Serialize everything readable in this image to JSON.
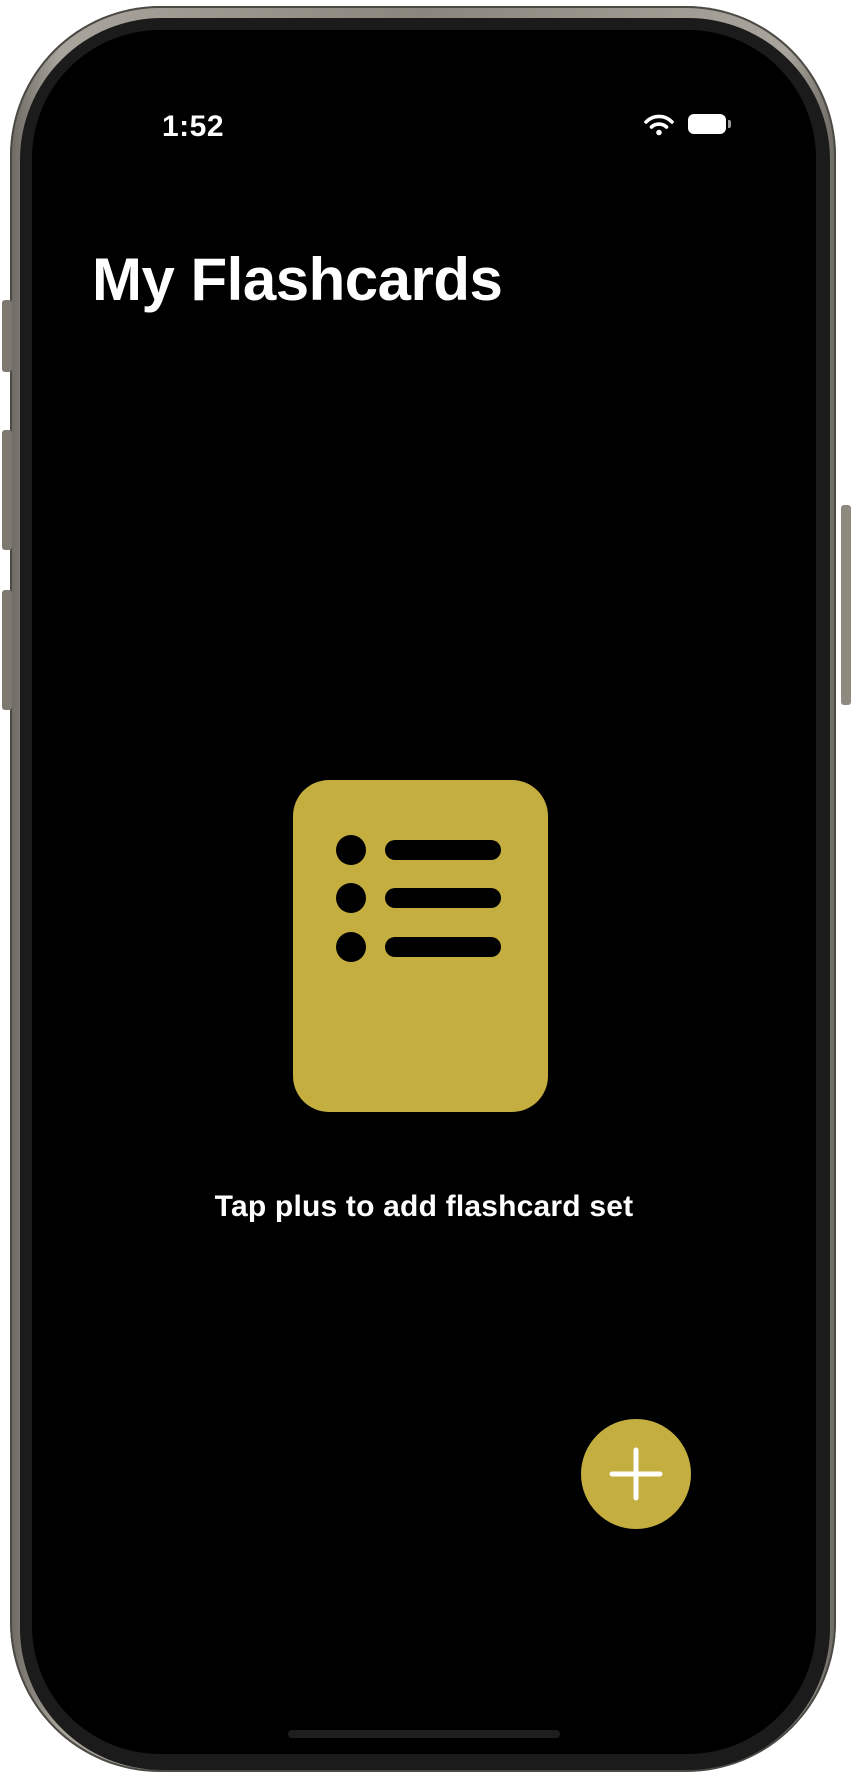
{
  "status_bar": {
    "time": "1:52",
    "icons": [
      "wifi-icon",
      "battery-icon"
    ]
  },
  "header": {
    "title": "My Flashcards"
  },
  "empty_state": {
    "icon": "list-document-icon",
    "message": "Tap plus to add flashcard set"
  },
  "fab": {
    "icon": "plus-icon"
  },
  "colors": {
    "background": "#000000",
    "accent": "#c4ae3f",
    "text": "#ffffff"
  }
}
